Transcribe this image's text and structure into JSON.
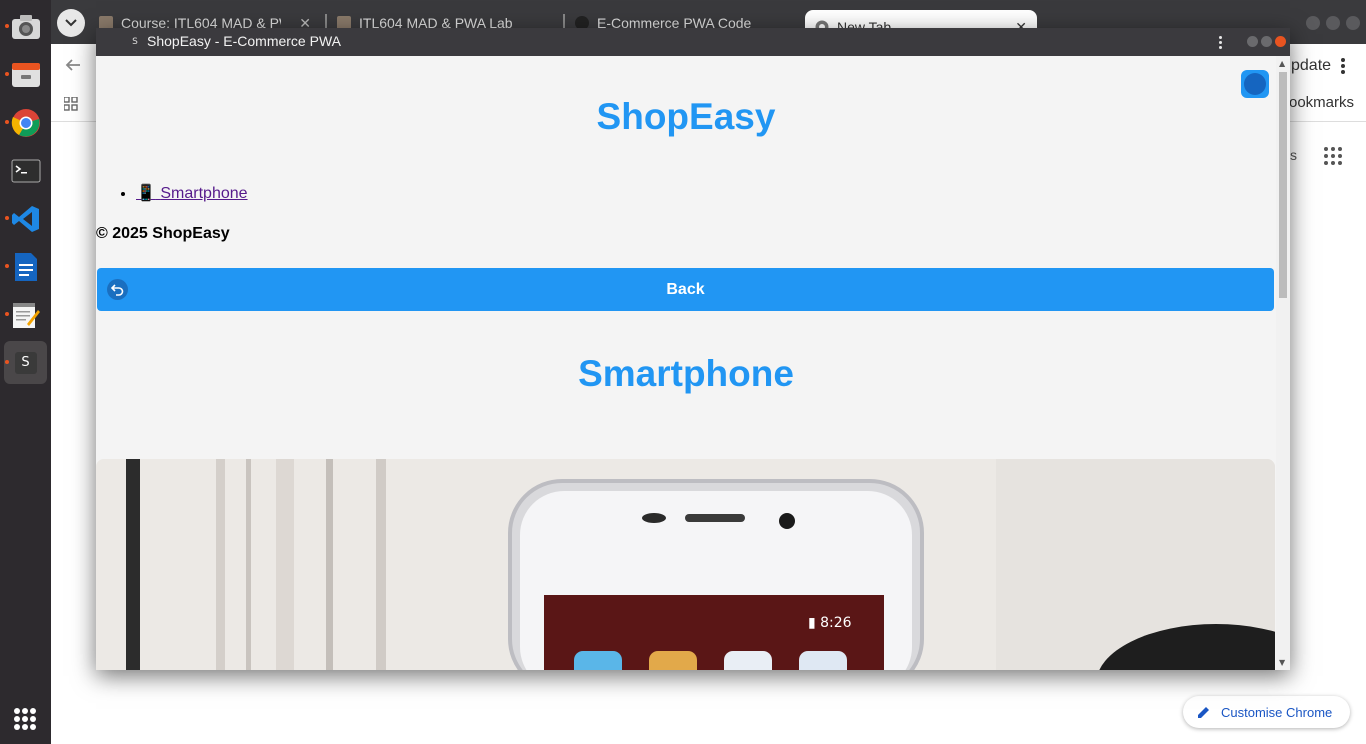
{
  "background_chrome": {
    "tabs": [
      {
        "label": "Course: ITL604 MAD & PWA"
      },
      {
        "label": "ITL604 MAD & PWA Lab"
      },
      {
        "label": "E-Commerce PWA Code"
      },
      {
        "label": "New Tab"
      }
    ],
    "toolbar_update_label": "pdate",
    "bookmarks_label": "ookmarks",
    "partial_text": "s",
    "customise_label": "Customise Chrome"
  },
  "dock": {
    "items": [
      "camera-app",
      "files-app",
      "chrome-app",
      "terminal-app",
      "vscode-app",
      "writer-app",
      "text-editor-app",
      "shopeasy-app"
    ],
    "shopeasy_letter": "S"
  },
  "pwa": {
    "window_title": "ShopEasy - E-Commerce PWA",
    "favicon_letter": "S",
    "site_title": "ShopEasy",
    "nav_items": [
      {
        "icon": "📱",
        "label": "Smartphone"
      }
    ],
    "footer": "© 2025 ShopEasy",
    "back_label": "Back",
    "product_title": "Smartphone",
    "product_image": {
      "alt": "smartphone-photo",
      "status_time": "8:26"
    }
  },
  "colors": {
    "accent": "#2196f3",
    "link_visited": "#551a8b",
    "page_bg": "#f4f4f4",
    "close_button": "#e95420"
  }
}
